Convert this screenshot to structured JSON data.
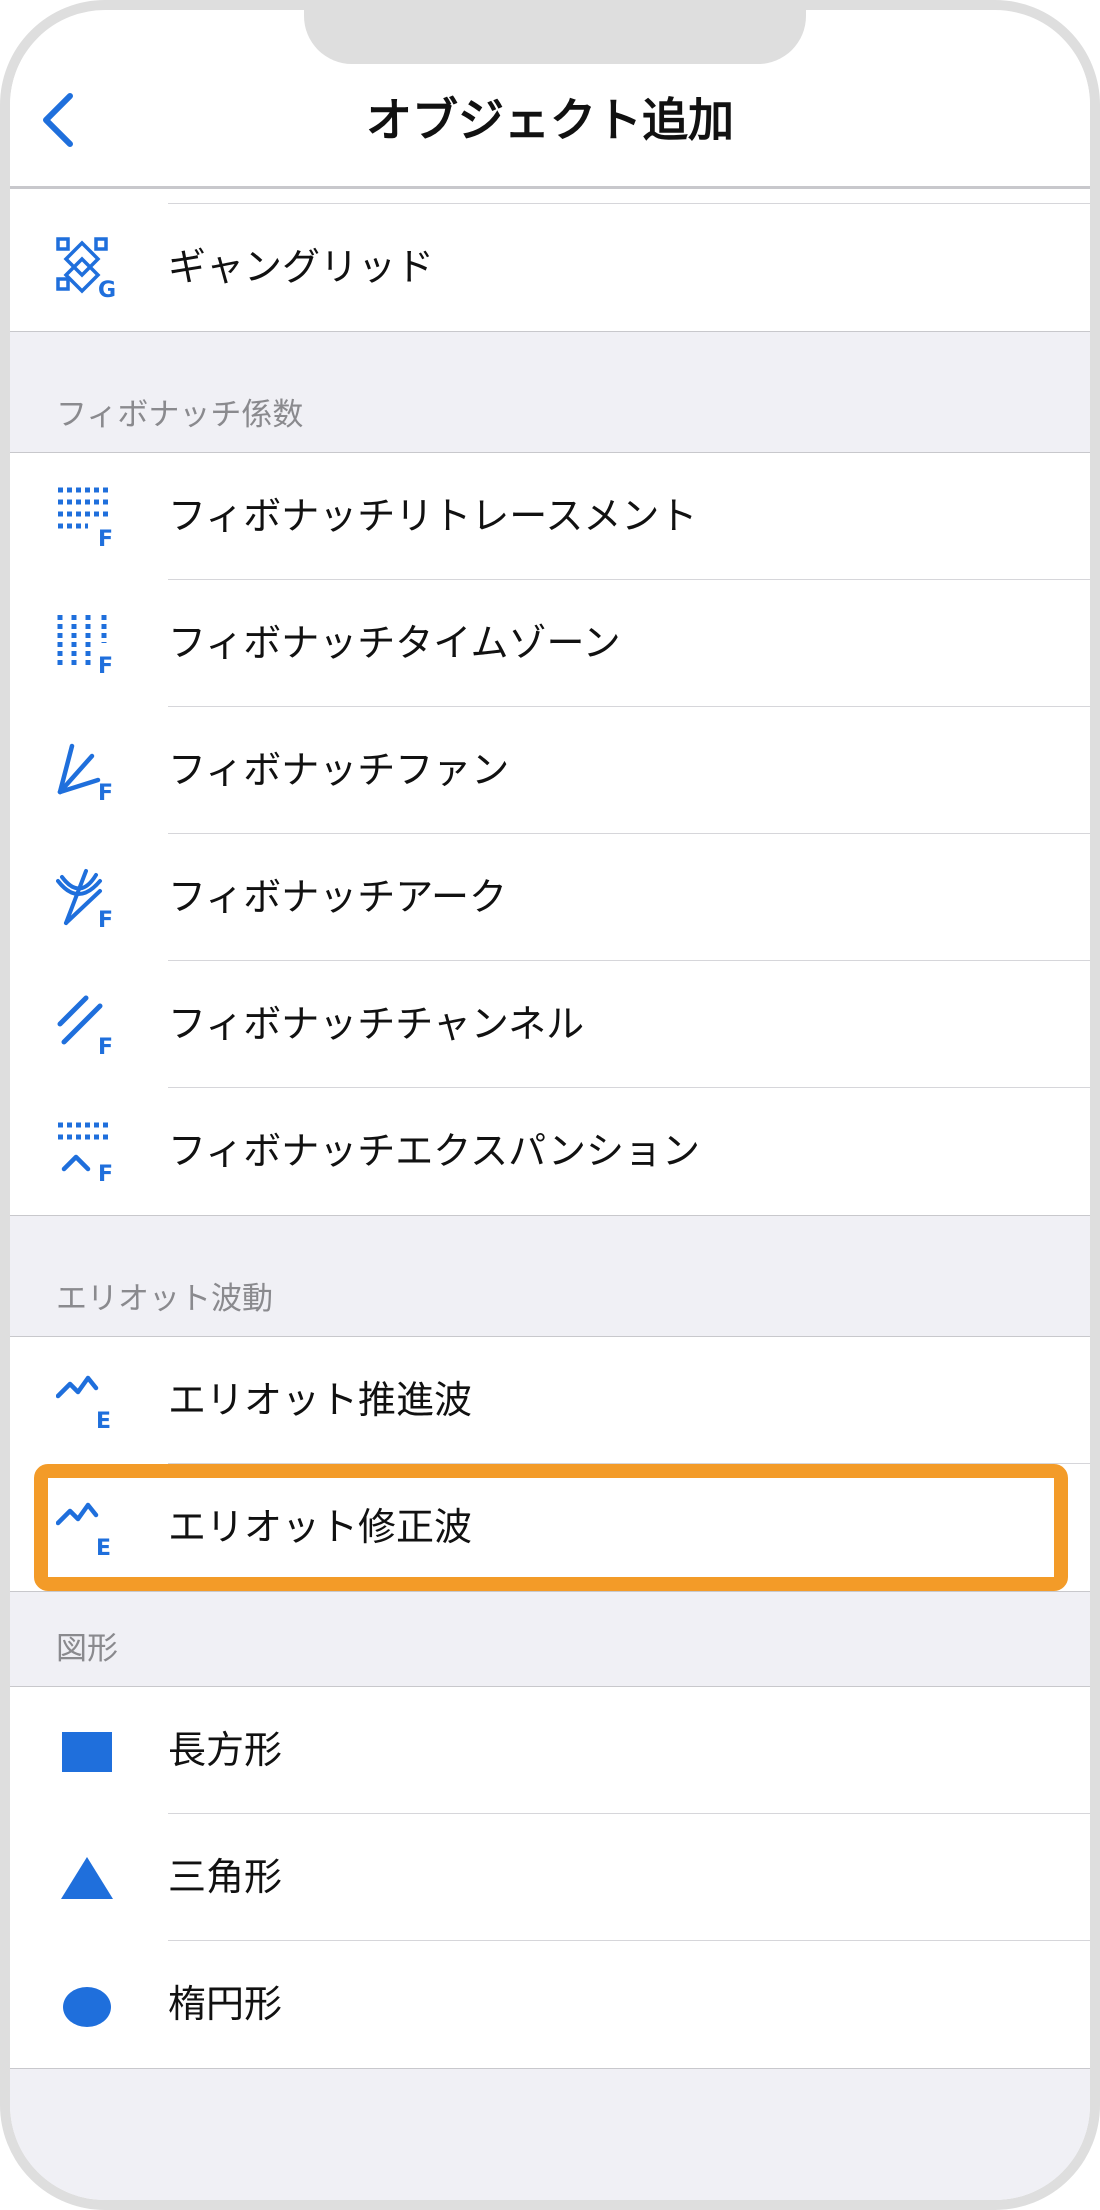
{
  "header": {
    "title": "オブジェクト追加"
  },
  "gann": {
    "label": "ギャングリッド"
  },
  "fibonacci": {
    "section_title": "フィボナッチ係数",
    "items": [
      {
        "label": "フィボナッチリトレースメント",
        "icon": "fibonacci-retracement-icon"
      },
      {
        "label": "フィボナッチタイムゾーン",
        "icon": "fibonacci-timezone-icon"
      },
      {
        "label": "フィボナッチファン",
        "icon": "fibonacci-fan-icon"
      },
      {
        "label": "フィボナッチアーク",
        "icon": "fibonacci-arc-icon"
      },
      {
        "label": "フィボナッチチャンネル",
        "icon": "fibonacci-channel-icon"
      },
      {
        "label": "フィボナッチエクスパンション",
        "icon": "fibonacci-expansion-icon"
      }
    ]
  },
  "elliott": {
    "section_title": "エリオット波動",
    "items": [
      {
        "label": "エリオット推進波",
        "icon": "elliott-impulse-icon"
      },
      {
        "label": "エリオット修正波",
        "icon": "elliott-correction-icon",
        "highlighted": true
      }
    ]
  },
  "shapes": {
    "section_title": "図形",
    "items": [
      {
        "label": "長方形",
        "icon": "rectangle-icon"
      },
      {
        "label": "三角形",
        "icon": "triangle-icon"
      },
      {
        "label": "楕円形",
        "icon": "ellipse-icon"
      }
    ]
  },
  "colors": {
    "accent": "#1f6fdc",
    "highlight": "#f39b28",
    "background": "#f0f0f5"
  }
}
